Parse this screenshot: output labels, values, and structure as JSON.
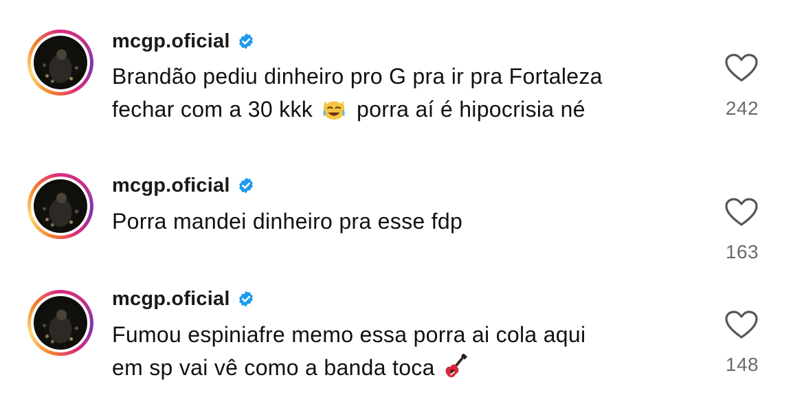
{
  "comments": [
    {
      "username": "mcgp.oficial",
      "text_line1": "Brandão pediu dinheiro pro G pra ir pra Fortaleza",
      "text_line2_before": "fechar com a 30 kkk",
      "text_line2_emoji": "joy-cat-emoji",
      "text_line2_after": "porra aí é hipocrisia né",
      "likes": "242"
    },
    {
      "username": "mcgp.oficial",
      "text_line1": "Porra mandei dinheiro pra esse fdp",
      "likes": "163"
    },
    {
      "username": "mcgp.oficial",
      "text_line1": "Fumou espiniafre memo essa porra ai cola aqui",
      "text_line2_before": "em sp vai vê como a banda toca",
      "text_line2_emoji": "guitar-emoji",
      "likes": "148"
    }
  ],
  "colors": {
    "verified": "#1d9bf0",
    "like_count": "#6b6b6b",
    "heart_outline": "#555555"
  }
}
